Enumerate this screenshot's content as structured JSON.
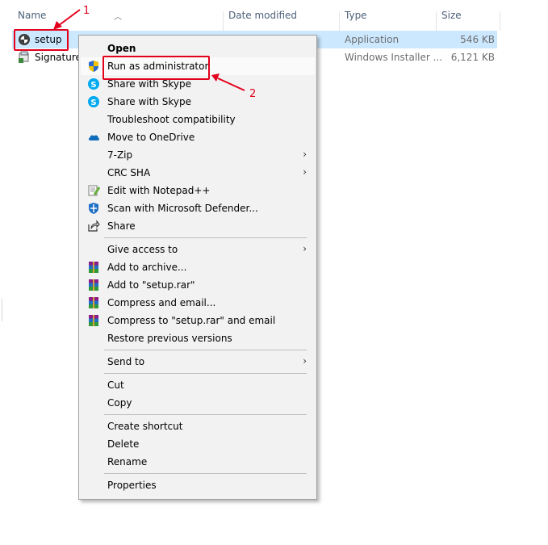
{
  "columns": {
    "name": "Name",
    "date": "Date modified",
    "type": "Type",
    "size": "Size"
  },
  "files": [
    {
      "name": "setup",
      "type": "Application",
      "size": "546 KB"
    },
    {
      "name": "SignatureM",
      "type": "Windows Installer ...",
      "size": "6,121 KB"
    }
  ],
  "annotations": {
    "step1": "1",
    "step2": "2"
  },
  "menu": {
    "open": "Open",
    "run_admin": "Run as administrator",
    "skype1": "Share with Skype",
    "skype2": "Share with Skype",
    "troubleshoot": "Troubleshoot compatibility",
    "onedrive": "Move to OneDrive",
    "zip7": "7-Zip",
    "crcsha": "CRC SHA",
    "notepadpp": "Edit with Notepad++",
    "defender": "Scan with Microsoft Defender...",
    "share": "Share",
    "give_access": "Give access to",
    "add_archive": "Add to archive...",
    "add_setup_rar": "Add to \"setup.rar\"",
    "compress_email": "Compress and email...",
    "compress_setup_email": "Compress to \"setup.rar\" and email",
    "restore": "Restore previous versions",
    "send_to": "Send to",
    "cut": "Cut",
    "copy": "Copy",
    "create_shortcut": "Create shortcut",
    "delete": "Delete",
    "rename": "Rename",
    "properties": "Properties",
    "submenu_arrow": "›"
  },
  "colors": {
    "selection": "#cce8ff",
    "annotation": "#e3001b",
    "header_text": "#4c607a"
  }
}
